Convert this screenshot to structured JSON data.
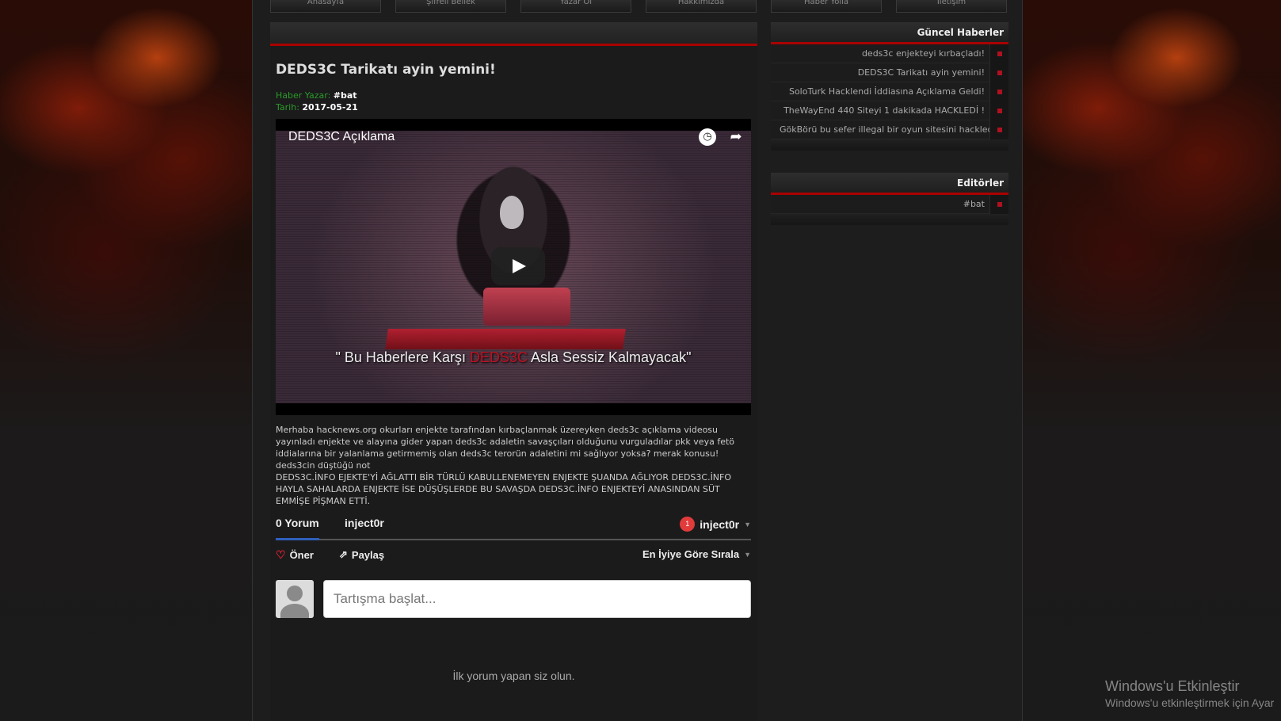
{
  "nav": {
    "items": [
      "Anasayfa",
      "Şifreli Bellek",
      "Yazar Ol",
      "Hakkımızda",
      "Haber Yolla",
      "İletişim"
    ]
  },
  "article": {
    "title": "DEDS3C Tarikatı ayin yemini!",
    "author_label": "Haber Yazar:",
    "author": "#bat",
    "date_label": "Tarih:",
    "date": "2017-05-21",
    "body": [
      "Merhaba hacknews.org okurları enjekte tarafından kırbaçlanmak üzereyken deds3c açıklama videosu yayınladı enjekte ve alayına gider yapan deds3c adaletin savaşçıları olduğunu vurguladılar pkk veya fetö iddialarına bir yalanlama getirmemiş olan deds3c terorün adaletini mi sağlıyor yoksa? merak konusu!",
      "deds3cin düştüğü not",
      "DEDS3C.İNFO EJEKTE'Yİ AĞLATTI BİR TÜRLÜ KABULLENEMEYEN ENJEKTE ŞUANDA AĞLIYOR DEDS3C.İNFO HAYLA SAHALARDA ENJEKTE İSE DÜŞÜŞLERDE BU SAVAŞDA DEDS3C.İNFO ENJEKTEYİ ANASINDAN SÜT EMMİŞE PİŞMAN ETTİ."
    ]
  },
  "video": {
    "title": "DEDS3C Açıklama",
    "caption_left": "\" Bu Haberlere Karşı ",
    "caption_red": "DEDS3C",
    "caption_right": " Asla Sessiz Kalmayacak\"",
    "icons": [
      "clock-icon",
      "share-icon",
      "play-icon"
    ]
  },
  "comments": {
    "count_label": "0 Yorum",
    "site_label": "inject0r",
    "notif_count": "1",
    "user_label": "inject0r",
    "recommend_label": "Öner",
    "share_label": "Paylaş",
    "sort_label": "En İyiye Göre Sırala",
    "input_placeholder": "Tartışma başlat...",
    "empty_text": "İlk yorum yapan siz olun."
  },
  "sidebar": {
    "news_title": "Güncel Haberler",
    "news": [
      "deds3c enjekteyi kırbaçladı!",
      "DEDS3C Tarikatı ayin yemini!",
      "SoloTurk Hacklendi İddiasına Açıklama Geldi!",
      "TheWayEnd 440 Siteyi 1 dakikada HACKLEDİ !",
      "GökBörü bu sefer illegal bir oyun sitesini hackledi!"
    ],
    "editors_title": "Editörler",
    "editors": [
      "#bat"
    ]
  },
  "watermark": {
    "line1": "Windows'u Etkinleştir",
    "line2": "Windows'u etkinleştirmek için Ayar"
  },
  "colors": {
    "accent_red": "#aa0000",
    "label_green": "#2a9a2a",
    "tab_underline": "#2e5fbd",
    "badge_red": "#e23b3b"
  }
}
